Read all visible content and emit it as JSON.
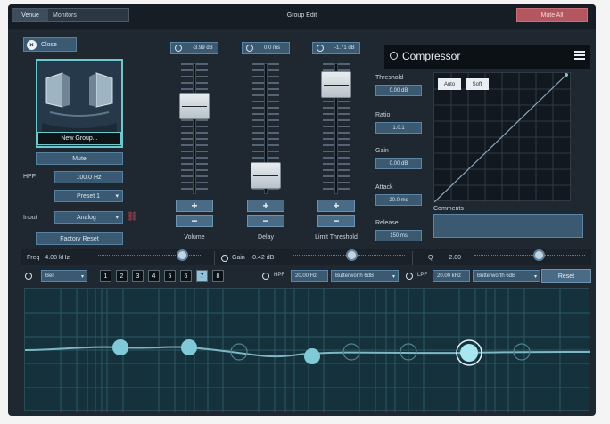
{
  "topbar": {
    "venue_label": "Venue",
    "venue_value": "Monitors",
    "title": "Group Edit",
    "mute_all": "Mute All"
  },
  "group": {
    "close_label": "Close",
    "new_group_label": "New Group...",
    "mute_label": "Mute",
    "hpf_label": "HPF",
    "hpf_value": "100.0 Hz",
    "preset_value": "Preset 1",
    "input_label": "Input",
    "input_value": "Analog",
    "factory_reset": "Factory Reset"
  },
  "faders": [
    {
      "label": "Volume",
      "value": "-3.99 dB",
      "level": 0.72
    },
    {
      "label": "Delay",
      "value": "0.0 ms",
      "level": 0.05
    },
    {
      "label": "Limit Threshold",
      "value": "-1.71 dB",
      "level": 0.92
    }
  ],
  "compressor": {
    "title": "Compressor",
    "threshold_label": "Threshold",
    "threshold_value": "0.00 dB",
    "ratio_label": "Ratio",
    "ratio_value": "1.0:1",
    "gain_label": "Gain",
    "gain_value": "0.00 dB",
    "attack_label": "Attack",
    "attack_value": "20.0 ms",
    "release_label": "Release",
    "release_value": "150 ms",
    "auto_label": "Auto",
    "soft_label": "Soft",
    "comments_label": "Comments"
  },
  "params": {
    "freq_label": "Freq",
    "freq_value": "4.08 kHz",
    "gain_label": "Gain",
    "gain_value": "-0.42 dB",
    "q_label": "Q",
    "q_value": "2.00"
  },
  "eq": {
    "type_value": "Bell",
    "bands": [
      "1",
      "2",
      "3",
      "4",
      "5",
      "6",
      "7",
      "8"
    ],
    "selected_band": "7",
    "hpf_label": "HPF",
    "hpf_value": "20.00 Hz",
    "hpf_filter": "Butterworth 6dB",
    "lpf_label": "LPF",
    "lpf_value": "20.00 kHz",
    "lpf_filter": "Butterworth 6dB",
    "reset_label": "Reset"
  }
}
